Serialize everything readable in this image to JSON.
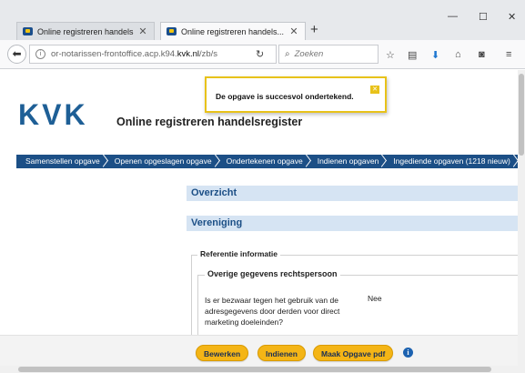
{
  "browser": {
    "tabs": [
      {
        "title": "Online registreren handels"
      },
      {
        "title": "Online registreren handels..."
      }
    ],
    "url": {
      "prefix": "or-notarissen-frontoffice.acp.k94.",
      "domain": "kvk.nl",
      "path": "/zb/s"
    },
    "search": {
      "placeholder": "Zoeken"
    },
    "icons": {
      "back": "back-arrow-icon",
      "info": "info-icon",
      "reload": "reload-icon",
      "search": "search-icon",
      "bookmark": "star-icon",
      "library": "library-icon",
      "download": "download-icon",
      "home": "home-icon",
      "pocket": "pocket-icon",
      "menu": "hamburger-menu-icon",
      "minimize": "minimize-icon",
      "maximize": "maximize-icon",
      "close": "close-icon"
    }
  },
  "header": {
    "logo": "KVK",
    "title": "Online registreren handelsregister"
  },
  "notification": {
    "message": "De opgave is succesvol ondertekend."
  },
  "steps": [
    {
      "label": "Samenstellen opgave"
    },
    {
      "label": "Openen opgeslagen opgave"
    },
    {
      "label": "Ondertekenen opgave"
    },
    {
      "label": "Indienen opgaven"
    },
    {
      "label": "Ingediende opgaven (1218 nieuw)"
    }
  ],
  "sections": {
    "overview": "Overzicht",
    "entity": "Vereniging"
  },
  "reference": {
    "legend": "Referentie informatie",
    "sub_legend": "Overige gegevens rechtspersoon",
    "question": "Is er bezwaar tegen het gebruik van de adresgegevens door derden voor direct marketing doeleinden?",
    "answer": "Nee"
  },
  "actions": {
    "edit": "Bewerken",
    "submit": "Indienen",
    "pdf": "Maak Opgave pdf"
  },
  "colors": {
    "brand": "#1e5f96",
    "step_bar": "#1c4f86",
    "section_bg": "#d6e4f3",
    "button": "#f4b516",
    "toast_border": "#e8c21a"
  }
}
